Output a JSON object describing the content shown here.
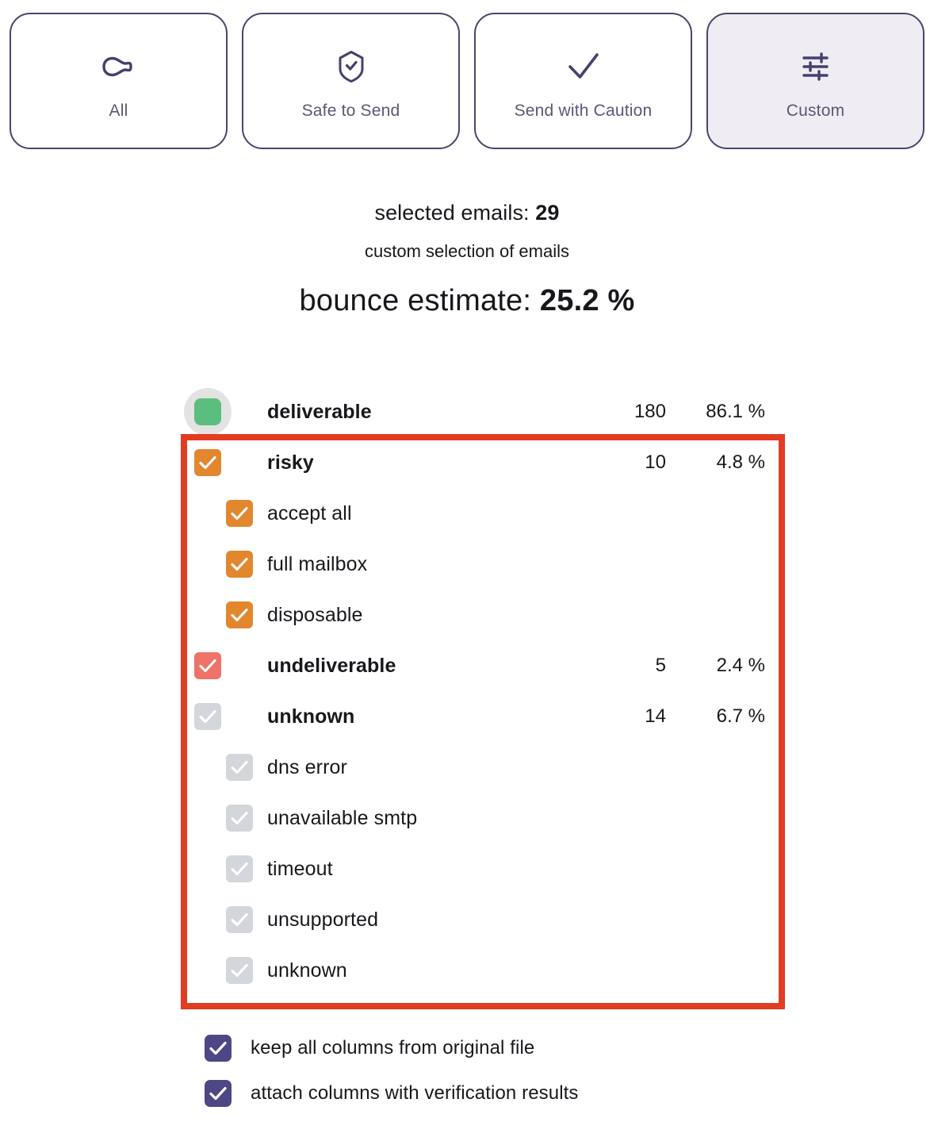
{
  "tabs": [
    {
      "id": "all",
      "label": "All",
      "icon": "infinity-icon",
      "selected": false
    },
    {
      "id": "safe-to-send",
      "label": "Safe to Send",
      "icon": "shield-check-icon",
      "selected": false
    },
    {
      "id": "send-with-caution",
      "label": "Send with Caution",
      "icon": "check-icon",
      "selected": false
    },
    {
      "id": "custom",
      "label": "Custom",
      "icon": "sliders-icon",
      "selected": true
    }
  ],
  "summary": {
    "selected_emails_label": "selected emails:",
    "selected_emails_value": "29",
    "description": "custom selection of emails",
    "bounce_estimate_label": "bounce estimate:",
    "bounce_estimate_value": "25.2 %"
  },
  "table": {
    "rows": [
      {
        "label": "deliverable",
        "count": "180",
        "pct": "86.1 %",
        "checkbox": "green",
        "state": "filled",
        "level": 0,
        "halo": true
      },
      {
        "label": "risky",
        "count": "10",
        "pct": "4.8 %",
        "checkbox": "orange",
        "state": "checked",
        "level": 0,
        "halo": false
      },
      {
        "label": "accept all",
        "count": "",
        "pct": "",
        "checkbox": "orange",
        "state": "checked",
        "level": 1,
        "halo": false
      },
      {
        "label": "full mailbox",
        "count": "",
        "pct": "",
        "checkbox": "orange",
        "state": "checked",
        "level": 1,
        "halo": false
      },
      {
        "label": "disposable",
        "count": "",
        "pct": "",
        "checkbox": "orange",
        "state": "checked",
        "level": 1,
        "halo": false
      },
      {
        "label": "undeliverable",
        "count": "5",
        "pct": "2.4 %",
        "checkbox": "red",
        "state": "checked",
        "level": 0,
        "halo": false
      },
      {
        "label": "unknown",
        "count": "14",
        "pct": "6.7 %",
        "checkbox": "grey",
        "state": "checked",
        "level": 0,
        "halo": false
      },
      {
        "label": "dns error",
        "count": "",
        "pct": "",
        "checkbox": "grey",
        "state": "checked",
        "level": 1,
        "halo": false
      },
      {
        "label": "unavailable smtp",
        "count": "",
        "pct": "",
        "checkbox": "grey",
        "state": "checked",
        "level": 1,
        "halo": false
      },
      {
        "label": "timeout",
        "count": "",
        "pct": "",
        "checkbox": "grey",
        "state": "checked",
        "level": 1,
        "halo": false
      },
      {
        "label": "unsupported",
        "count": "",
        "pct": "",
        "checkbox": "grey",
        "state": "checked",
        "level": 1,
        "halo": false
      },
      {
        "label": "unknown",
        "count": "",
        "pct": "",
        "checkbox": "grey",
        "state": "checked",
        "level": 1,
        "halo": false
      }
    ]
  },
  "options": [
    {
      "id": "keep-all-columns",
      "label": "keep all columns from original file",
      "checked": true
    },
    {
      "id": "attach-columns",
      "label": "attach columns with verification results",
      "checked": true
    }
  ],
  "annotation": {
    "highlight_color": "#e23d22"
  },
  "colors": {
    "accent_purple": "#4e4785",
    "deliverable_green": "#5cbe7e",
    "risky_orange": "#e3872f",
    "undeliverable_red": "#ef7368",
    "unknown_grey": "#d3d6da",
    "highlight_red": "#e23d22",
    "tab_border": "#4a4470",
    "tab_selected_bg": "#efecf3"
  }
}
